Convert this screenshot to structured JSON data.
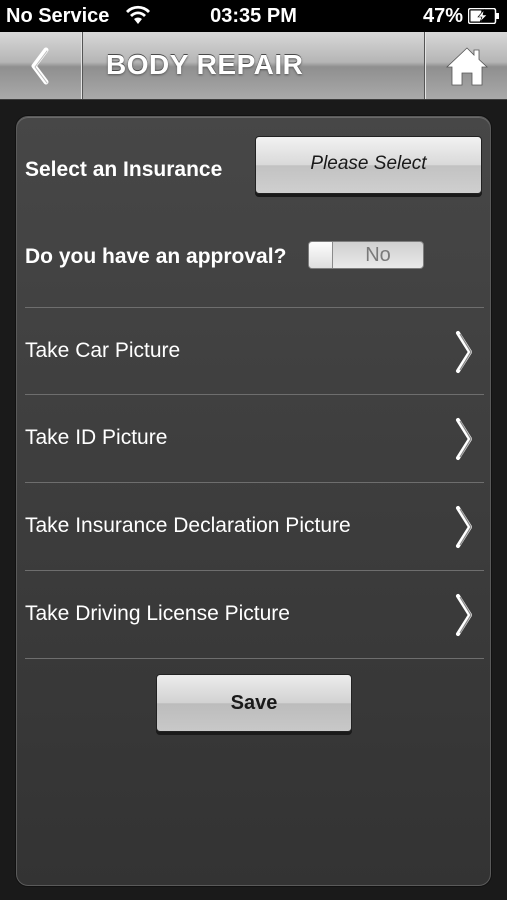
{
  "status_bar": {
    "carrier": "No Service",
    "time": "03:35 PM",
    "battery_percent": "47%",
    "battery_level": 0.47,
    "wifi_icon": "wifi-icon",
    "battery_icon": "battery-charging-icon"
  },
  "nav": {
    "title": "BODY REPAIR",
    "back_icon": "chevron-left-icon",
    "home_icon": "home-icon"
  },
  "form": {
    "insurance_label": "Select an Insurance",
    "insurance_select": "Please Select",
    "approval_label": "Do you have an approval?",
    "approval_toggle": "No",
    "rows": [
      {
        "label": "Take Car Picture"
      },
      {
        "label": "Take ID Picture"
      },
      {
        "label": "Take Insurance Declaration Picture"
      },
      {
        "label": "Take Driving License Picture"
      }
    ],
    "save_label": "Save"
  },
  "colors": {
    "background": "#1a1a1a",
    "panel": "#3d3d3d",
    "text": "#ffffff"
  }
}
